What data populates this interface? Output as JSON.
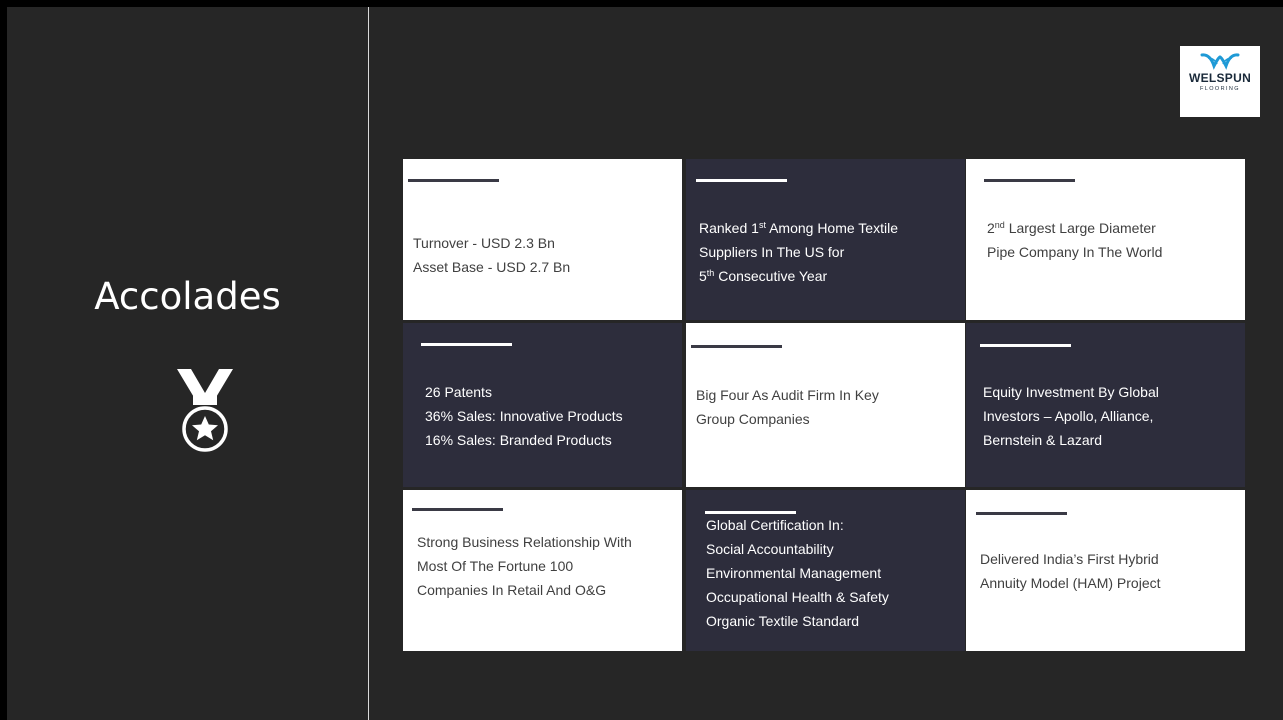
{
  "slide": {
    "title": "Accolades",
    "medal_icon": "medal-star-icon",
    "colors": {
      "background": "#262626",
      "card_dark": "#2d2d3c",
      "card_white": "#ffffff",
      "logo_blue": "#1f9ad6"
    }
  },
  "logo": {
    "brand": "WELSPUN",
    "subtitle": "FLOORING"
  },
  "cards": [
    {
      "lines": [
        "Turnover  - USD 2.3 Bn",
        "Asset Base - USD 2.7 Bn"
      ]
    },
    {
      "line1_pre": "Ranked 1",
      "line1_sup": "st",
      "line1_post": " Among Home Textile",
      "line2": "Suppliers In The US for",
      "line3_sup_pre": "5",
      "line3_sup": "th",
      "line3_post": " Consecutive Year"
    },
    {
      "line1_pre": "2",
      "line1_sup": "nd",
      "line1_post": " Largest Large Diameter",
      "line2": "Pipe Company In The World"
    },
    {
      "lines": [
        "26 Patents",
        "36% Sales: Innovative Products",
        "16% Sales: Branded Products"
      ]
    },
    {
      "lines": [
        "Big Four As Audit Firm In Key",
        "Group Companies"
      ]
    },
    {
      "lines": [
        "Equity Investment By Global",
        "Investors – Apollo, Alliance,",
        "Bernstein & Lazard"
      ]
    },
    {
      "lines": [
        "Strong Business Relationship With",
        "Most Of The Fortune 100",
        "Companies In Retail And O&G"
      ]
    },
    {
      "lines": [
        "Global Certification In:",
        "Social Accountability",
        "Environmental Management",
        "Occupational Health & Safety",
        "Organic Textile Standard"
      ]
    },
    {
      "lines": [
        "Delivered India’s First Hybrid",
        "Annuity Model (HAM) Project"
      ]
    }
  ]
}
